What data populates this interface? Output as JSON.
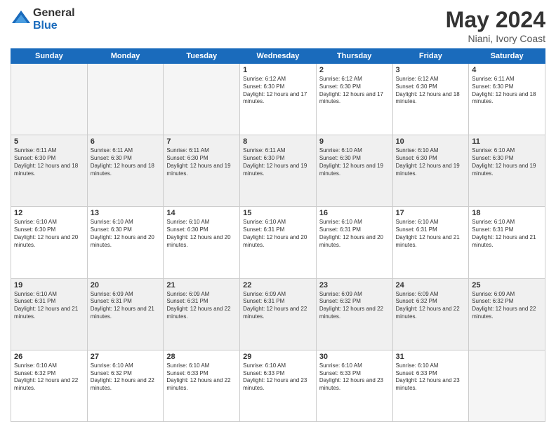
{
  "logo": {
    "general": "General",
    "blue": "Blue"
  },
  "title": {
    "month_year": "May 2024",
    "location": "Niani, Ivory Coast"
  },
  "days_of_week": [
    "Sunday",
    "Monday",
    "Tuesday",
    "Wednesday",
    "Thursday",
    "Friday",
    "Saturday"
  ],
  "weeks": [
    [
      {
        "day": "",
        "sunrise": "",
        "sunset": "",
        "daylight": "",
        "empty": true
      },
      {
        "day": "",
        "sunrise": "",
        "sunset": "",
        "daylight": "",
        "empty": true
      },
      {
        "day": "",
        "sunrise": "",
        "sunset": "",
        "daylight": "",
        "empty": true
      },
      {
        "day": "1",
        "sunrise": "Sunrise: 6:12 AM",
        "sunset": "Sunset: 6:30 PM",
        "daylight": "Daylight: 12 hours and 17 minutes.",
        "empty": false
      },
      {
        "day": "2",
        "sunrise": "Sunrise: 6:12 AM",
        "sunset": "Sunset: 6:30 PM",
        "daylight": "Daylight: 12 hours and 17 minutes.",
        "empty": false
      },
      {
        "day": "3",
        "sunrise": "Sunrise: 6:12 AM",
        "sunset": "Sunset: 6:30 PM",
        "daylight": "Daylight: 12 hours and 18 minutes.",
        "empty": false
      },
      {
        "day": "4",
        "sunrise": "Sunrise: 6:11 AM",
        "sunset": "Sunset: 6:30 PM",
        "daylight": "Daylight: 12 hours and 18 minutes.",
        "empty": false
      }
    ],
    [
      {
        "day": "5",
        "sunrise": "Sunrise: 6:11 AM",
        "sunset": "Sunset: 6:30 PM",
        "daylight": "Daylight: 12 hours and 18 minutes.",
        "empty": false
      },
      {
        "day": "6",
        "sunrise": "Sunrise: 6:11 AM",
        "sunset": "Sunset: 6:30 PM",
        "daylight": "Daylight: 12 hours and 18 minutes.",
        "empty": false
      },
      {
        "day": "7",
        "sunrise": "Sunrise: 6:11 AM",
        "sunset": "Sunset: 6:30 PM",
        "daylight": "Daylight: 12 hours and 19 minutes.",
        "empty": false
      },
      {
        "day": "8",
        "sunrise": "Sunrise: 6:11 AM",
        "sunset": "Sunset: 6:30 PM",
        "daylight": "Daylight: 12 hours and 19 minutes.",
        "empty": false
      },
      {
        "day": "9",
        "sunrise": "Sunrise: 6:10 AM",
        "sunset": "Sunset: 6:30 PM",
        "daylight": "Daylight: 12 hours and 19 minutes.",
        "empty": false
      },
      {
        "day": "10",
        "sunrise": "Sunrise: 6:10 AM",
        "sunset": "Sunset: 6:30 PM",
        "daylight": "Daylight: 12 hours and 19 minutes.",
        "empty": false
      },
      {
        "day": "11",
        "sunrise": "Sunrise: 6:10 AM",
        "sunset": "Sunset: 6:30 PM",
        "daylight": "Daylight: 12 hours and 19 minutes.",
        "empty": false
      }
    ],
    [
      {
        "day": "12",
        "sunrise": "Sunrise: 6:10 AM",
        "sunset": "Sunset: 6:30 PM",
        "daylight": "Daylight: 12 hours and 20 minutes.",
        "empty": false
      },
      {
        "day": "13",
        "sunrise": "Sunrise: 6:10 AM",
        "sunset": "Sunset: 6:30 PM",
        "daylight": "Daylight: 12 hours and 20 minutes.",
        "empty": false
      },
      {
        "day": "14",
        "sunrise": "Sunrise: 6:10 AM",
        "sunset": "Sunset: 6:30 PM",
        "daylight": "Daylight: 12 hours and 20 minutes.",
        "empty": false
      },
      {
        "day": "15",
        "sunrise": "Sunrise: 6:10 AM",
        "sunset": "Sunset: 6:31 PM",
        "daylight": "Daylight: 12 hours and 20 minutes.",
        "empty": false
      },
      {
        "day": "16",
        "sunrise": "Sunrise: 6:10 AM",
        "sunset": "Sunset: 6:31 PM",
        "daylight": "Daylight: 12 hours and 20 minutes.",
        "empty": false
      },
      {
        "day": "17",
        "sunrise": "Sunrise: 6:10 AM",
        "sunset": "Sunset: 6:31 PM",
        "daylight": "Daylight: 12 hours and 21 minutes.",
        "empty": false
      },
      {
        "day": "18",
        "sunrise": "Sunrise: 6:10 AM",
        "sunset": "Sunset: 6:31 PM",
        "daylight": "Daylight: 12 hours and 21 minutes.",
        "empty": false
      }
    ],
    [
      {
        "day": "19",
        "sunrise": "Sunrise: 6:10 AM",
        "sunset": "Sunset: 6:31 PM",
        "daylight": "Daylight: 12 hours and 21 minutes.",
        "empty": false
      },
      {
        "day": "20",
        "sunrise": "Sunrise: 6:09 AM",
        "sunset": "Sunset: 6:31 PM",
        "daylight": "Daylight: 12 hours and 21 minutes.",
        "empty": false
      },
      {
        "day": "21",
        "sunrise": "Sunrise: 6:09 AM",
        "sunset": "Sunset: 6:31 PM",
        "daylight": "Daylight: 12 hours and 22 minutes.",
        "empty": false
      },
      {
        "day": "22",
        "sunrise": "Sunrise: 6:09 AM",
        "sunset": "Sunset: 6:31 PM",
        "daylight": "Daylight: 12 hours and 22 minutes.",
        "empty": false
      },
      {
        "day": "23",
        "sunrise": "Sunrise: 6:09 AM",
        "sunset": "Sunset: 6:32 PM",
        "daylight": "Daylight: 12 hours and 22 minutes.",
        "empty": false
      },
      {
        "day": "24",
        "sunrise": "Sunrise: 6:09 AM",
        "sunset": "Sunset: 6:32 PM",
        "daylight": "Daylight: 12 hours and 22 minutes.",
        "empty": false
      },
      {
        "day": "25",
        "sunrise": "Sunrise: 6:09 AM",
        "sunset": "Sunset: 6:32 PM",
        "daylight": "Daylight: 12 hours and 22 minutes.",
        "empty": false
      }
    ],
    [
      {
        "day": "26",
        "sunrise": "Sunrise: 6:10 AM",
        "sunset": "Sunset: 6:32 PM",
        "daylight": "Daylight: 12 hours and 22 minutes.",
        "empty": false
      },
      {
        "day": "27",
        "sunrise": "Sunrise: 6:10 AM",
        "sunset": "Sunset: 6:32 PM",
        "daylight": "Daylight: 12 hours and 22 minutes.",
        "empty": false
      },
      {
        "day": "28",
        "sunrise": "Sunrise: 6:10 AM",
        "sunset": "Sunset: 6:33 PM",
        "daylight": "Daylight: 12 hours and 22 minutes.",
        "empty": false
      },
      {
        "day": "29",
        "sunrise": "Sunrise: 6:10 AM",
        "sunset": "Sunset: 6:33 PM",
        "daylight": "Daylight: 12 hours and 23 minutes.",
        "empty": false
      },
      {
        "day": "30",
        "sunrise": "Sunrise: 6:10 AM",
        "sunset": "Sunset: 6:33 PM",
        "daylight": "Daylight: 12 hours and 23 minutes.",
        "empty": false
      },
      {
        "day": "31",
        "sunrise": "Sunrise: 6:10 AM",
        "sunset": "Sunset: 6:33 PM",
        "daylight": "Daylight: 12 hours and 23 minutes.",
        "empty": false
      },
      {
        "day": "",
        "sunrise": "",
        "sunset": "",
        "daylight": "",
        "empty": true
      }
    ]
  ]
}
